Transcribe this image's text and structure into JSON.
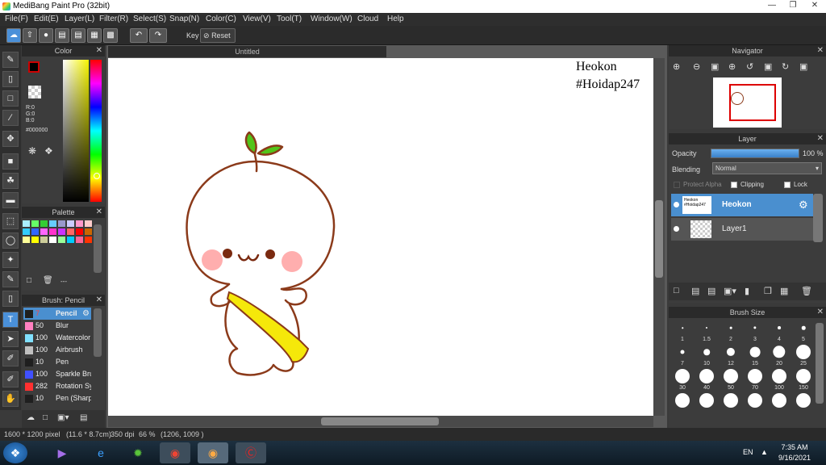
{
  "app": {
    "title": "MediBang Paint Pro (32bit)"
  },
  "menus": [
    "File(F)",
    "Edit(E)",
    "Layer(L)",
    "Filter(R)",
    "Select(S)",
    "Snap(N)",
    "Color(C)",
    "View(V)",
    "Tool(T)",
    "Window(W)",
    "Cloud",
    "Help"
  ],
  "toolbar": {
    "key_label": "Key",
    "reset_label": "Reset"
  },
  "color_panel": {
    "title": "Color",
    "r": "R:0",
    "g": "G:0",
    "b": "B:0",
    "hex": "#000000"
  },
  "palette_panel": {
    "title": "Palette",
    "footer": "---"
  },
  "brush_panel": {
    "title": "Brush: Pencil",
    "brushes": [
      {
        "size": "7",
        "name": "Pencil",
        "color": "#1f1f1f"
      },
      {
        "size": "50",
        "name": "Blur",
        "color": "#ff80c0"
      },
      {
        "size": "100",
        "name": "Watercolor",
        "color": "#80e0ff"
      },
      {
        "size": "100",
        "name": "Airbrush",
        "color": "#c0c0c0"
      },
      {
        "size": "10",
        "name": "Pen",
        "color": "#1f1f1f"
      },
      {
        "size": "100",
        "name": "Sparkle Brush",
        "color": "#4050ff"
      },
      {
        "size": "282",
        "name": "Rotation Symmetry",
        "color": "#ff3030"
      },
      {
        "size": "10",
        "name": "Pen (Sharp)",
        "color": "#1f1f1f"
      }
    ]
  },
  "canvas": {
    "tab_title": "Untitled",
    "text_line1": "Heokon",
    "text_line2": "#Hoidap247"
  },
  "navigator_panel": {
    "title": "Navigator"
  },
  "layer_panel": {
    "title": "Layer",
    "opacity_label": "Opacity",
    "opacity_value": "100 %",
    "opacity_fraction": 1.0,
    "blending_label": "Blending",
    "blending_value": "Normal",
    "protect_alpha": "Protect Alpha",
    "clipping": "Clipping",
    "lock": "Lock",
    "layers": [
      {
        "name": "Heokon",
        "thumb_text": "Heokon #Hoidap247",
        "selected": true
      },
      {
        "name": "Layer1",
        "selected": false
      }
    ]
  },
  "brush_size_panel": {
    "title": "Brush Size",
    "sizes": [
      "1",
      "1.5",
      "2",
      "3",
      "4",
      "5",
      "7",
      "10",
      "12",
      "15",
      "20",
      "25",
      "30",
      "40",
      "50",
      "70",
      "100",
      "150",
      "",
      "",
      "",
      "",
      "",
      ""
    ]
  },
  "status": {
    "size": "1600 * 1200 pixel",
    "physical": "(11.6 * 8.7cm)",
    "dpi": "350 dpi",
    "zoom": "66 %",
    "coords": "(1206, 1009 )"
  },
  "taskbar": {
    "lang": "EN",
    "time": "7:35 AM",
    "date": "9/16/2021"
  },
  "colors": {
    "panel_bg": "#3c3c3c",
    "accent": "#4a90d9",
    "selected_layer": "#4a8fcf",
    "outline": "#8b3a1a",
    "leaf": "#52c41a",
    "bag": "#f5e80a",
    "blush": "#ff6b6b"
  }
}
